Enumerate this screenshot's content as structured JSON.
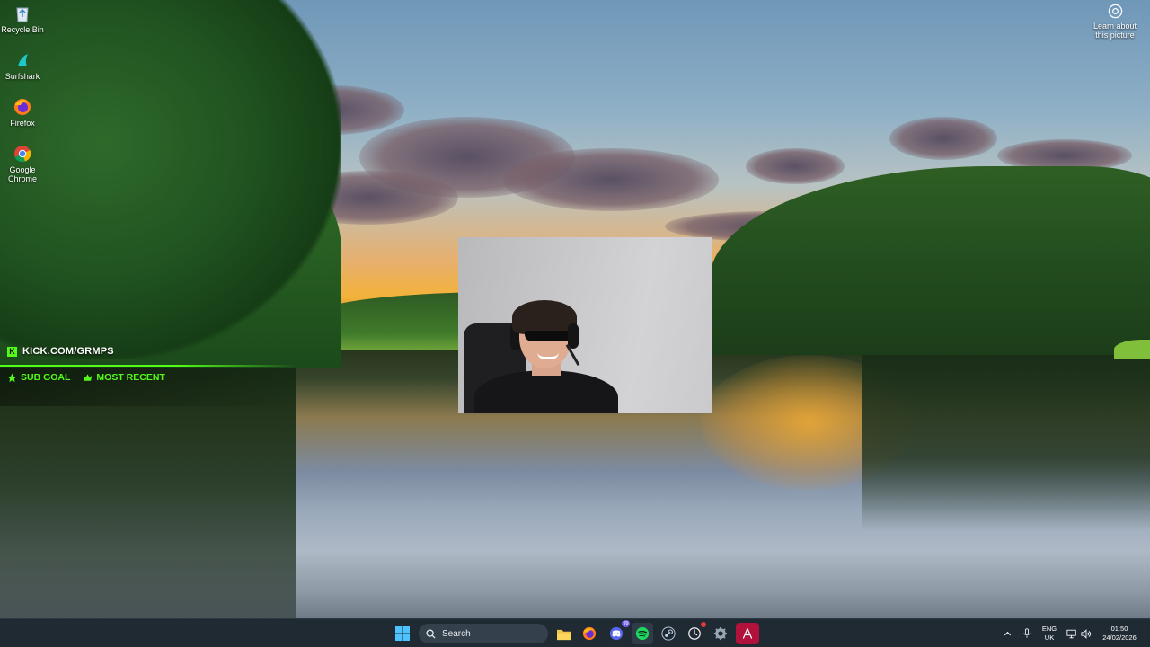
{
  "desktop": {
    "icons": [
      {
        "label": "Recycle Bin",
        "icon": "recycle-bin-icon"
      },
      {
        "label": "Surfshark",
        "icon": "surfshark-icon"
      },
      {
        "label": "Firefox",
        "icon": "firefox-icon"
      },
      {
        "label": "Google Chrome",
        "icon": "chrome-icon"
      }
    ],
    "learn_about": {
      "label": "Learn about this picture",
      "icon": "camera-icon"
    }
  },
  "kick_overlay": {
    "url": "KICK.COM/GRMPS",
    "sub_goal": "SUB GOAL",
    "most_recent": "MOST RECENT",
    "accent": "#53fc18"
  },
  "taskbar": {
    "search_placeholder": "Search",
    "discord_badge": "99",
    "apps": [
      "start-icon",
      "file-explorer-icon",
      "firefox-icon",
      "discord-icon",
      "spotify-icon",
      "steam-icon",
      "stats-icon",
      "settings-icon",
      "app-icon"
    ],
    "tray": {
      "language_top": "ENG",
      "language_bottom": "UK",
      "time": "01:50",
      "date": "24/02/2026"
    }
  }
}
